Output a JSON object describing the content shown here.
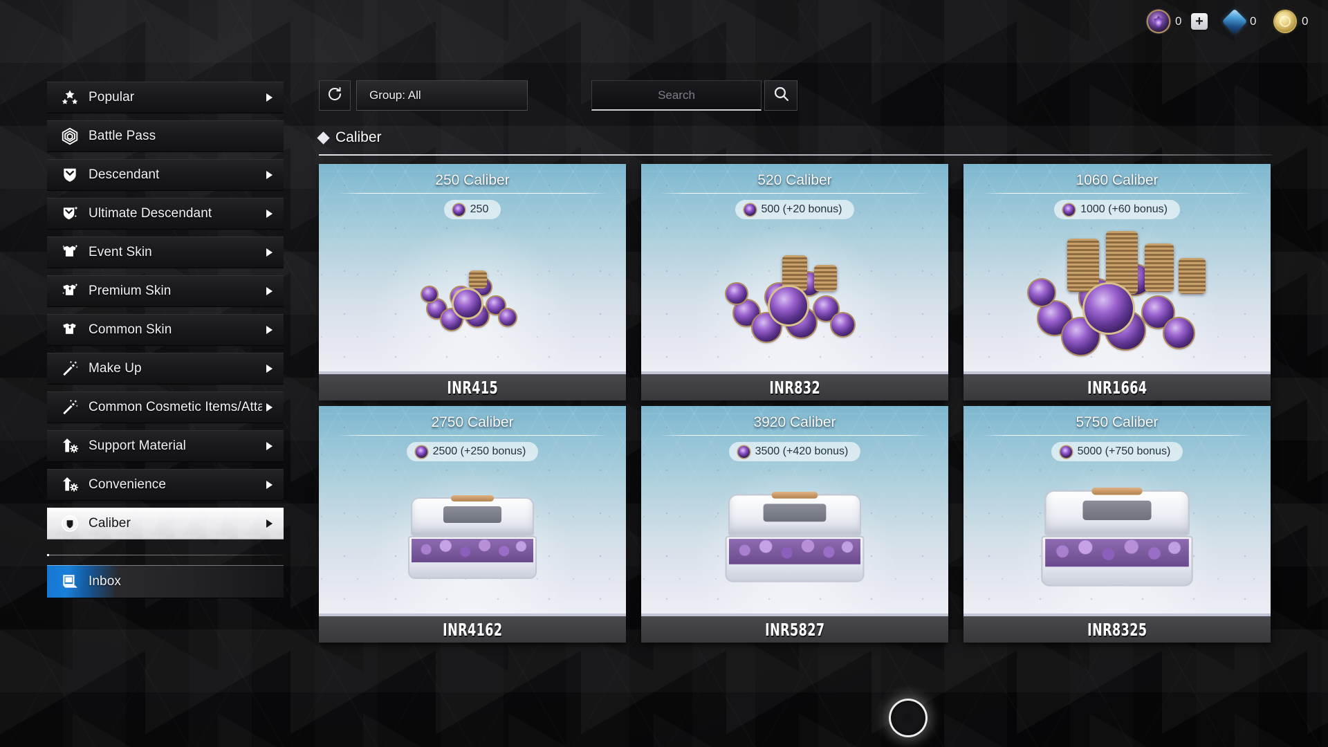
{
  "topbar": {
    "currencies": [
      {
        "icon": "caliber-coin-icon",
        "value": "0",
        "has_plus": true,
        "plus_label": "+"
      },
      {
        "icon": "blue-crystal-icon",
        "value": "0",
        "has_plus": false
      },
      {
        "icon": "gold-coin-icon",
        "value": "0",
        "has_plus": false
      }
    ]
  },
  "sidebar": {
    "items": [
      {
        "label": "Popular",
        "icon": "stars-icon",
        "arrow": true,
        "selected": false
      },
      {
        "label": "Battle Pass",
        "icon": "hexagon-spiral-icon",
        "arrow": false,
        "selected": false
      },
      {
        "label": "Descendant",
        "icon": "shield-chevron-icon",
        "arrow": true,
        "selected": false
      },
      {
        "label": "Ultimate Descendant",
        "icon": "shield-chevron-sparkle-icon",
        "arrow": true,
        "selected": false
      },
      {
        "label": "Event Skin",
        "icon": "shirt-sparkle-icon",
        "arrow": true,
        "selected": false
      },
      {
        "label": "Premium Skin",
        "icon": "shirt-gem-sparkle-icon",
        "arrow": true,
        "selected": false
      },
      {
        "label": "Common Skin",
        "icon": "shirt-icon",
        "arrow": true,
        "selected": false
      },
      {
        "label": "Make Up",
        "icon": "magic-wand-icon",
        "arrow": true,
        "selected": false
      },
      {
        "label": "Common Cosmetic Items/Atta",
        "icon": "magic-wand-icon",
        "arrow": true,
        "selected": false
      },
      {
        "label": "Support Material",
        "icon": "upgrade-gear-icon",
        "arrow": true,
        "selected": false
      },
      {
        "label": "Convenience",
        "icon": "upgrade-gear-icon",
        "arrow": true,
        "selected": false
      },
      {
        "label": "Caliber",
        "icon": "caliber-emblem-icon",
        "arrow": true,
        "selected": true
      }
    ],
    "inbox": {
      "label": "Inbox",
      "icon": "inbox-mail-icon"
    }
  },
  "toolbar": {
    "refresh_icon": "refresh-icon",
    "group_label": "Group: All",
    "search_placeholder": "Search",
    "search_value": "",
    "search_icon": "search-icon"
  },
  "section": {
    "title": "Caliber",
    "marker_icon": "diamond-icon"
  },
  "products": [
    {
      "title": "250 Caliber",
      "amount": "250",
      "price": "INR415",
      "art": "coins-small"
    },
    {
      "title": "520 Caliber",
      "amount": "500 (+20 bonus)",
      "price": "INR832",
      "art": "coins-medium"
    },
    {
      "title": "1060 Caliber",
      "amount": "1000 (+60 bonus)",
      "price": "INR1664",
      "art": "coins-large"
    },
    {
      "title": "2750 Caliber",
      "amount": "2500 (+250 bonus)",
      "price": "INR4162",
      "art": "chest-small"
    },
    {
      "title": "3920 Caliber",
      "amount": "3500 (+420 bonus)",
      "price": "INR5827",
      "art": "chest-medium"
    },
    {
      "title": "5750 Caliber",
      "amount": "5000 (+750 bonus)",
      "price": "INR8325",
      "art": "chest-large"
    }
  ],
  "colors": {
    "accent_blue": "#1478d4",
    "card_top": "#7db7cf",
    "card_bottom": "#eceef5",
    "price_bar": "#41414 5",
    "selected_nav": "#e9e9ec"
  },
  "status": {
    "loading_indicator": "loading-spinner"
  }
}
